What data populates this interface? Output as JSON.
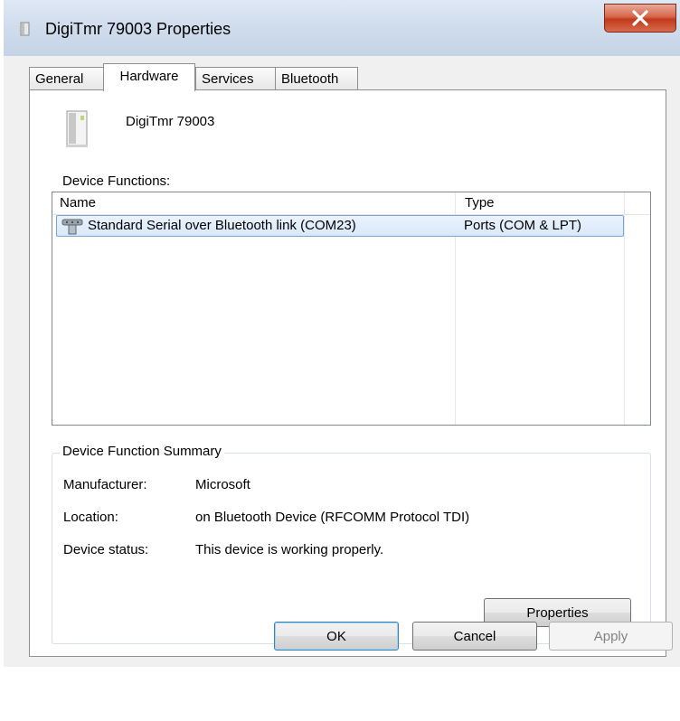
{
  "window": {
    "title": "DigiTmr 79003 Properties",
    "close_icon": "close-icon",
    "close_color": "#c23a1b"
  },
  "tabs": [
    {
      "label": "General",
      "active": false
    },
    {
      "label": "Hardware",
      "active": true
    },
    {
      "label": "Services",
      "active": false
    },
    {
      "label": "Bluetooth",
      "active": false
    }
  ],
  "device": {
    "name": "DigiTmr 79003",
    "icon": "device-icon"
  },
  "functions": {
    "label": "Device Functions:",
    "columns": [
      "Name",
      "Type"
    ],
    "rows": [
      {
        "name": "Standard Serial over Bluetooth link (COM23)",
        "type": "Ports (COM & LPT)",
        "icon": "serial-port-icon",
        "selected": true
      }
    ]
  },
  "summary": {
    "title": "Device Function Summary",
    "manufacturer_label": "Manufacturer:",
    "manufacturer_value": "Microsoft",
    "location_label": "Location:",
    "location_value": "on Bluetooth Device (RFCOMM Protocol TDI)",
    "status_label": "Device status:",
    "status_value": "This device is working properly.",
    "properties_button": "Properties"
  },
  "buttons": {
    "ok": "OK",
    "cancel": "Cancel",
    "apply": "Apply"
  }
}
